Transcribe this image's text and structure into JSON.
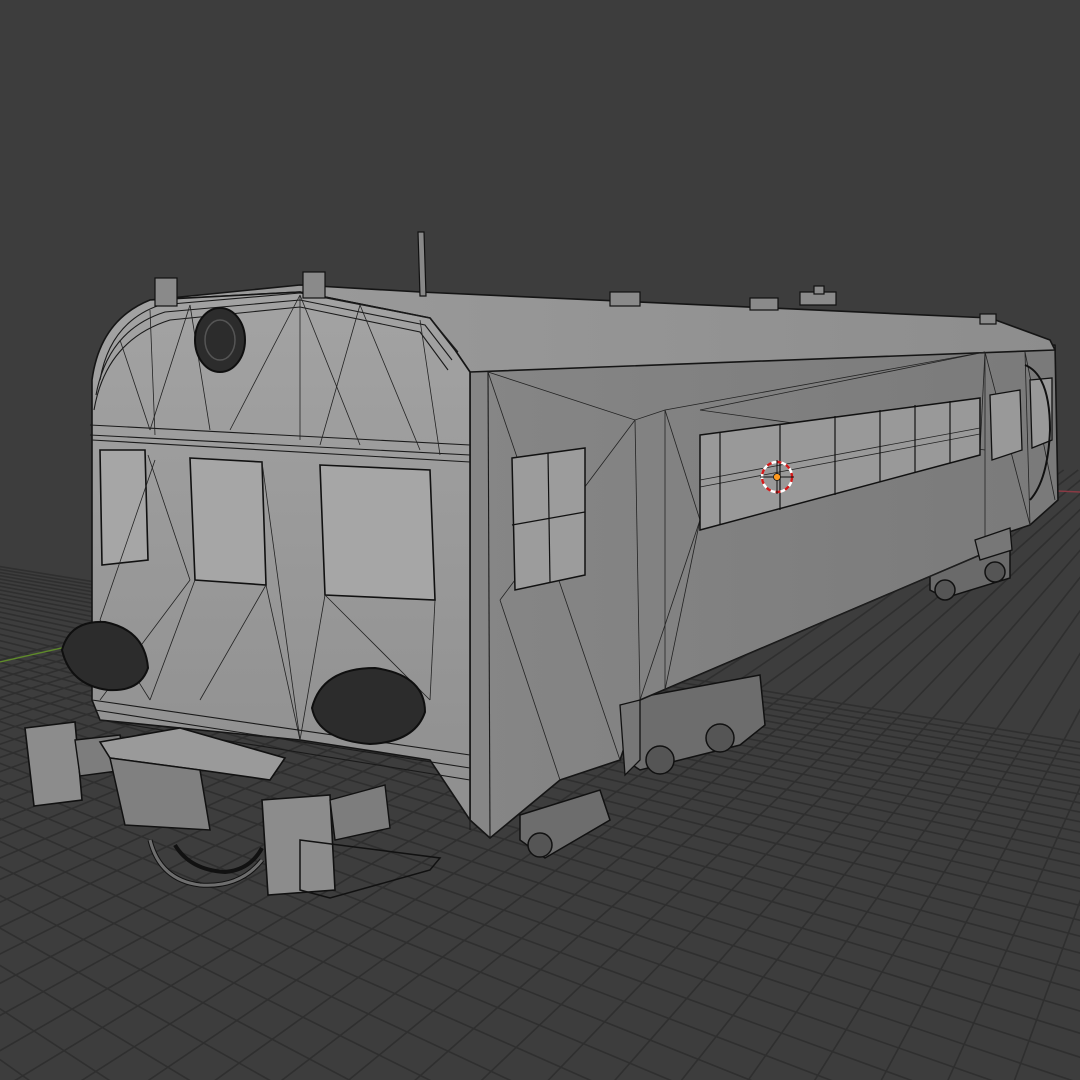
{
  "app": {
    "name": "3D viewport",
    "view_mode": "wireframe-solid"
  },
  "viewport": {
    "background_color": "#3d3d3d",
    "grid_color": "#2f2f2f",
    "x_axis_color": "#8a3a44",
    "y_axis_color": "#5f8a2a"
  },
  "scene": {
    "object": "railcar-model",
    "icons": {
      "object_origin": "object-origin-icon",
      "cursor_3d": "3d-cursor-icon"
    },
    "colors": {
      "front_face": "#9e9e9e",
      "side_face": "#8a8a8a",
      "roof": "#9a9a9a",
      "windows": "#a8a8a8",
      "under_gear": "#6e6e6e",
      "origin_marker": "#ff9a1f",
      "cursor_ring_red": "#d11a1a"
    }
  }
}
